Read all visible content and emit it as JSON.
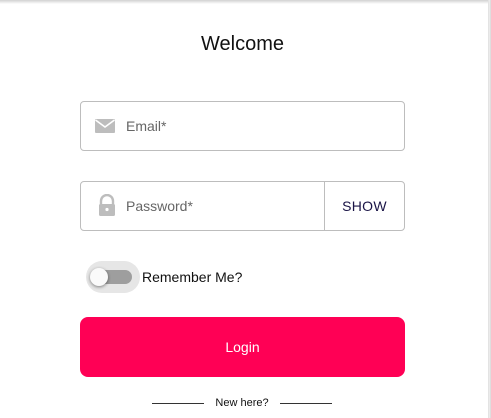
{
  "form": {
    "title": "Welcome",
    "email": {
      "placeholder": "Email*",
      "value": "",
      "icon": "envelope-icon"
    },
    "password": {
      "placeholder": "Password*",
      "value": "",
      "icon": "lock-icon",
      "show_label": "SHOW"
    },
    "remember": {
      "label": "Remember Me?",
      "checked": false
    },
    "login_label": "Login",
    "new_here_label": "New here?"
  },
  "colors": {
    "accent": "#ff0055",
    "border": "#bdbdbd",
    "icon": "#bdbdbd"
  }
}
